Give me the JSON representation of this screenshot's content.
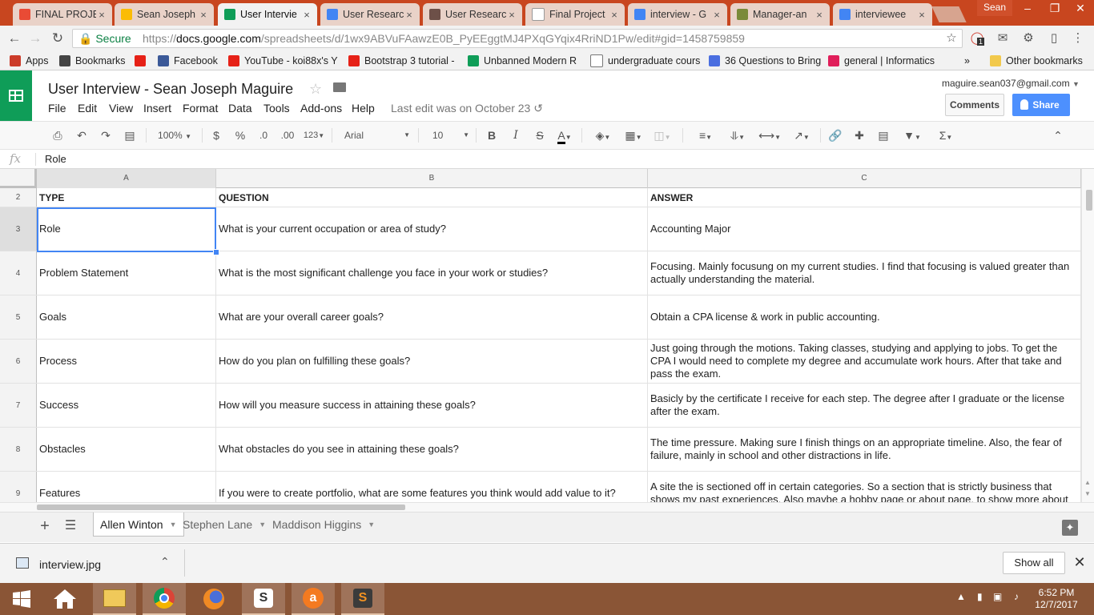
{
  "browser": {
    "tabs": [
      {
        "title": "FINAL PROJE",
        "color": "#e94b35"
      },
      {
        "title": "Sean Joseph",
        "color": "#fbbc05"
      },
      {
        "title": "User Intervie",
        "color": "#0f9d58"
      },
      {
        "title": "User Researc",
        "color": "#4285f4"
      },
      {
        "title": "User Researc",
        "color": "#6d5048"
      },
      {
        "title": "Final Project",
        "color": "#ffffff"
      },
      {
        "title": "interview - G",
        "color": "#4285f4"
      },
      {
        "title": "Manager-an",
        "color": "#7a8a39"
      },
      {
        "title": "interviewee",
        "color": "#4285f4"
      }
    ],
    "profile_name": "Sean",
    "secure_label": "Secure",
    "url_scheme": "https://",
    "url_host": "docs.google.com",
    "url_path": "/spreadsheets/d/1wx9ABVuFAawzE0B_PyEEggtMJ4PXqGYqix4RriND1Pw/edit#gid=1458759859",
    "extension_badge": "1",
    "bookmarks": [
      {
        "label": "Apps",
        "icon": "apps-grid-icon",
        "color": "#cc3c2a"
      },
      {
        "label": "Bookmarks",
        "icon": "star-icon",
        "color": "#444444"
      },
      {
        "label": "",
        "icon": "youtube-icon",
        "color": "#e62117"
      },
      {
        "label": "Facebook",
        "icon": "facebook-icon",
        "color": "#3b5998"
      },
      {
        "label": "YouTube - koi88x's Y",
        "icon": "youtube-icon",
        "color": "#e62117"
      },
      {
        "label": "Bootstrap 3 tutorial -",
        "icon": "youtube-icon",
        "color": "#e62117"
      },
      {
        "label": "Unbanned Modern R",
        "icon": "sheets-icon",
        "color": "#0f9d58"
      },
      {
        "label": "undergraduate cours",
        "icon": "page-icon",
        "color": "#ffffff"
      },
      {
        "label": "36 Questions to Bring",
        "icon": "pt-icon",
        "color": "#4a6ee0"
      },
      {
        "label": "general | Informatics",
        "icon": "slack-icon",
        "color": "#e01e5a"
      }
    ],
    "bookmarks_more": "»",
    "other_bookmarks": "Other bookmarks"
  },
  "doc": {
    "title": "User Interview - Sean Joseph Maguire",
    "menus": [
      "File",
      "Edit",
      "View",
      "Insert",
      "Format",
      "Data",
      "Tools",
      "Add-ons",
      "Help"
    ],
    "last_edit": "Last edit was on October 23",
    "account_email": "maguire.sean037@gmail.com",
    "comments_label": "Comments",
    "share_label": "Share"
  },
  "format_toolbar": {
    "zoom": "100%",
    "currency": "$",
    "percent": "%",
    "decrease_decimal": ".0",
    "increase_decimal": ".00",
    "more_formats": "123",
    "font": "Arial",
    "font_size": "10",
    "bold": "B",
    "italic": "I",
    "strike": "S",
    "text_color": "A",
    "text_color_value": "#000000"
  },
  "formula_bar": {
    "label": "fx",
    "value": "Role"
  },
  "sheet": {
    "columns": [
      "A",
      "B",
      "C"
    ],
    "rows": [
      {
        "num": "2",
        "cells": [
          "TYPE",
          "QUESTION",
          "ANSWER"
        ],
        "header": true
      },
      {
        "num": "3",
        "cells": [
          "Role",
          "What is your current occupation or area of study?",
          "Accounting Major"
        ]
      },
      {
        "num": "4",
        "cells": [
          "Problem Statement",
          "What is the most significant challenge you face in your work or studies?",
          "Focusing. Mainly focusung on my current studies. I find that focusing is valued greater than actually understanding the material."
        ]
      },
      {
        "num": "5",
        "cells": [
          "Goals",
          "What are your overall career goals?",
          "Obtain a CPA license & work in public accounting."
        ]
      },
      {
        "num": "6",
        "cells": [
          "Process",
          "How do you plan on fulfilling these goals?",
          "Just going through the motions. Taking classes, studying and applying to jobs. To get the CPA I would need to complete my degree and accumulate work hours. After that take and pass the exam."
        ]
      },
      {
        "num": "7",
        "cells": [
          "Success",
          "How will you measure success in attaining these goals?",
          "Basicly by the certificate I receive for each step. The degree after I graduate or the license after the exam."
        ]
      },
      {
        "num": "8",
        "cells": [
          "Obstacles",
          "What obstacles do you see in attaining these goals?",
          "The time pressure. Making sure I finish things on an appropriate timeline. Also, the fear of failure, mainly in school and other distractions in life."
        ]
      },
      {
        "num": "9",
        "cells": [
          "Features",
          "If you were to create portfolio, what are some features you think would add value to it?",
          "A site the is sectioned off in certain categories. So a section that is strictly business that shows my past experiences. Also maybe a hobby page or about page, to show more about"
        ]
      }
    ],
    "tabs": [
      "Allen Winton",
      "Stephen Lane",
      "Maddison Higgins"
    ],
    "active_tab": "Allen Winton"
  },
  "download": {
    "filename": "interview.jpg",
    "show_all": "Show all"
  },
  "taskbar": {
    "time": "6:52 PM",
    "date": "12/7/2017"
  }
}
